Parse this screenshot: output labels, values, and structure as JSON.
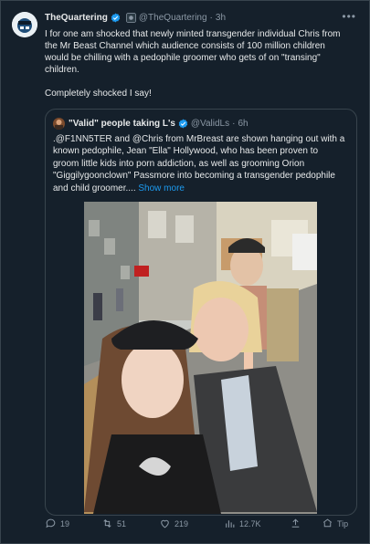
{
  "tweet": {
    "name": "TheQuartering",
    "handle": "@TheQuartering",
    "separator": "·",
    "time": "3h",
    "text_line1": "I for one am shocked that newly minted transgender individual Chris from",
    "text_line2": "the Mr Beast Channel which audience consists of 100 million children",
    "text_line3": "would be chilling with a pedophile groomer who gets of on \"transing\"",
    "text_line4": "children.",
    "text_line5": "Completely shocked I say!"
  },
  "quote": {
    "name": "\"Valid\" people taking L's",
    "handle": "@ValidLs",
    "separator": "·",
    "time": "6h",
    "text_line1": ".@F1NN5TER and @Chris from MrBreast are shown hanging out with a",
    "text_line2": "known pedophile, Jean \"Ella\" Hollywood, who has been proven to",
    "text_line3": "groom little kids into porn addiction, as well as grooming Orion",
    "text_line4": "\"Giggilygoonclown\" Passmore into becoming a transgender pedophile",
    "text_line5": "and child groomer....",
    "show_more": "Show more"
  },
  "actions": {
    "replies": "19",
    "retweets": "51",
    "likes": "219",
    "views": "12.7K",
    "tip": "Tip"
  },
  "colors": {
    "background": "#15202b",
    "text": "#e7e9ea",
    "muted": "#8b98a5",
    "accent": "#1d9bf0",
    "border": "#38444d"
  },
  "icons": [
    "avatar-icon",
    "verified-badge-icon",
    "more-icon",
    "reply-icon",
    "retweet-icon",
    "like-icon",
    "views-icon",
    "bookmark-icon",
    "tip-icon"
  ]
}
